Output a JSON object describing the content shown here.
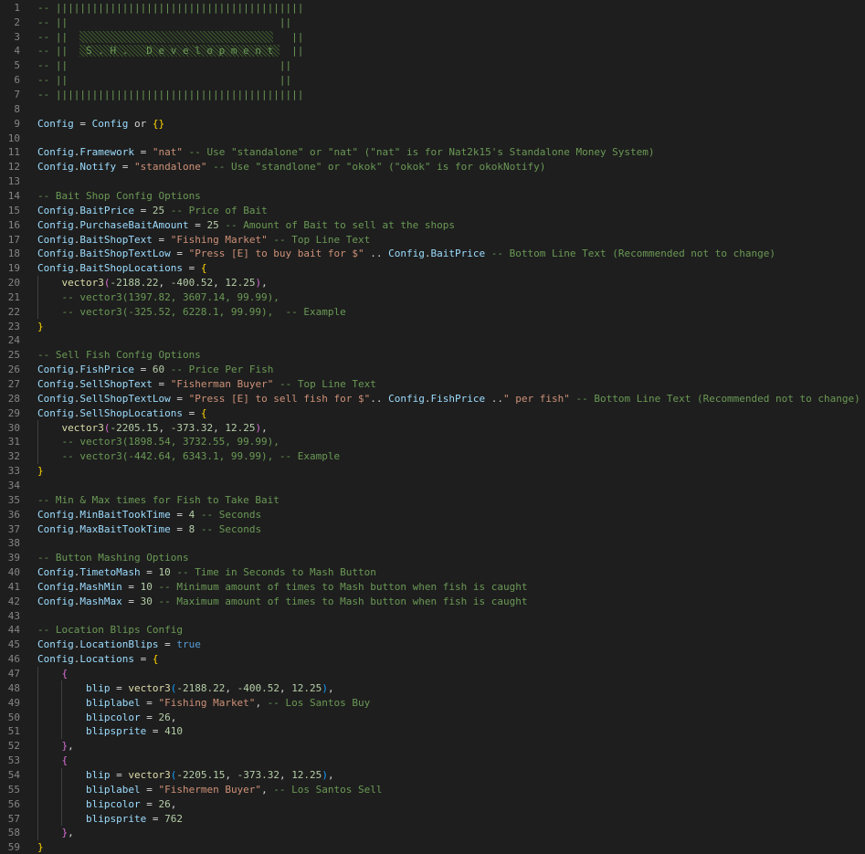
{
  "editor": {
    "lines": [
      [
        [
          "c",
          "-- |||||||||||||||||||||||||||||||||||||||||"
        ]
      ],
      [
        [
          "c",
          "-- ||                                   ||"
        ]
      ],
      [
        [
          "c",
          "-- ||  "
        ],
        [
          "banner",
          "                                "
        ],
        [
          "c",
          "   ||"
        ]
      ],
      [
        [
          "c",
          "-- ||  "
        ],
        [
          "banner",
          " S . H .   D e v e l o p m e n t "
        ],
        [
          "c",
          "  ||"
        ]
      ],
      [
        [
          "c",
          "-- ||                                   ||"
        ]
      ],
      [
        [
          "c",
          "-- ||                                   ||"
        ]
      ],
      [
        [
          "c",
          "-- |||||||||||||||||||||||||||||||||||||||||"
        ]
      ],
      [],
      [
        [
          "v",
          "Config"
        ],
        [
          "o",
          " = "
        ],
        [
          "v",
          "Config"
        ],
        [
          "o",
          " or "
        ],
        [
          "br",
          "{}"
        ]
      ],
      [],
      [
        [
          "v",
          "Config"
        ],
        [
          "o",
          "."
        ],
        [
          "v",
          "Framework"
        ],
        [
          "o",
          " = "
        ],
        [
          "s",
          "\"nat\""
        ],
        [
          "c",
          " -- Use \"standalone\" or \"nat\" (\"nat\" is for Nat2k15's Standalone Money System)"
        ]
      ],
      [
        [
          "v",
          "Config"
        ],
        [
          "o",
          "."
        ],
        [
          "v",
          "Notify"
        ],
        [
          "o",
          " = "
        ],
        [
          "s",
          "\"standalone\""
        ],
        [
          "c",
          " -- Use \"standlone\" or \"okok\" (\"okok\" is for okokNotify)"
        ]
      ],
      [],
      [
        [
          "c",
          "-- Bait Shop Config Options"
        ]
      ],
      [
        [
          "v",
          "Config"
        ],
        [
          "o",
          "."
        ],
        [
          "v",
          "BaitPrice"
        ],
        [
          "o",
          " = "
        ],
        [
          "n",
          "25"
        ],
        [
          "c",
          " -- Price of Bait"
        ]
      ],
      [
        [
          "v",
          "Config"
        ],
        [
          "o",
          "."
        ],
        [
          "v",
          "PurchaseBaitAmount"
        ],
        [
          "o",
          " = "
        ],
        [
          "n",
          "25"
        ],
        [
          "c",
          " -- Amount of Bait to sell at the shops"
        ]
      ],
      [
        [
          "v",
          "Config"
        ],
        [
          "o",
          "."
        ],
        [
          "v",
          "BaitShopText"
        ],
        [
          "o",
          " = "
        ],
        [
          "s",
          "\"Fishing Market\""
        ],
        [
          "c",
          " -- Top Line Text"
        ]
      ],
      [
        [
          "v",
          "Config"
        ],
        [
          "o",
          "."
        ],
        [
          "v",
          "BaitShopTextLow"
        ],
        [
          "o",
          " = "
        ],
        [
          "s",
          "\"Press [E] to buy bait for $\""
        ],
        [
          "o",
          " .. "
        ],
        [
          "v",
          "Config"
        ],
        [
          "o",
          "."
        ],
        [
          "v",
          "BaitPrice"
        ],
        [
          "c",
          " -- Bottom Line Text (Recommended not to change)"
        ]
      ],
      [
        [
          "v",
          "Config"
        ],
        [
          "o",
          "."
        ],
        [
          "v",
          "BaitShopLocations"
        ],
        [
          "o",
          " = "
        ],
        [
          "br",
          "{"
        ]
      ],
      [
        [
          "o",
          "    "
        ],
        [
          "p",
          "vector3"
        ],
        [
          "b2",
          "("
        ],
        [
          "n",
          "-2188.22"
        ],
        [
          "o",
          ", "
        ],
        [
          "n",
          "-400.52"
        ],
        [
          "o",
          ", "
        ],
        [
          "n",
          "12.25"
        ],
        [
          "b2",
          ")"
        ],
        [
          "o",
          ","
        ]
      ],
      [
        [
          "c",
          "    -- vector3(1397.82, 3607.14, 99.99),"
        ]
      ],
      [
        [
          "c",
          "    -- vector3(-325.52, 6228.1, 99.99),  -- Example"
        ]
      ],
      [
        [
          "br",
          "}"
        ]
      ],
      [],
      [
        [
          "c",
          "-- Sell Fish Config Options"
        ]
      ],
      [
        [
          "v",
          "Config"
        ],
        [
          "o",
          "."
        ],
        [
          "v",
          "FishPrice"
        ],
        [
          "o",
          " = "
        ],
        [
          "n",
          "60"
        ],
        [
          "c",
          " -- Price Per Fish"
        ]
      ],
      [
        [
          "v",
          "Config"
        ],
        [
          "o",
          "."
        ],
        [
          "v",
          "SellShopText"
        ],
        [
          "o",
          " = "
        ],
        [
          "s",
          "\"Fisherman Buyer\""
        ],
        [
          "c",
          " -- Top Line Text"
        ]
      ],
      [
        [
          "v",
          "Config"
        ],
        [
          "o",
          "."
        ],
        [
          "v",
          "SellShopTextLow"
        ],
        [
          "o",
          " = "
        ],
        [
          "s",
          "\"Press [E] to sell fish for $\""
        ],
        [
          "o",
          ".. "
        ],
        [
          "v",
          "Config"
        ],
        [
          "o",
          "."
        ],
        [
          "v",
          "FishPrice"
        ],
        [
          "o",
          " .."
        ],
        [
          "s",
          "\" per fish\""
        ],
        [
          "c",
          " -- Bottom Line Text (Recommended not to change)"
        ]
      ],
      [
        [
          "v",
          "Config"
        ],
        [
          "o",
          "."
        ],
        [
          "v",
          "SellShopLocations"
        ],
        [
          "o",
          " = "
        ],
        [
          "br",
          "{"
        ]
      ],
      [
        [
          "o",
          "    "
        ],
        [
          "p",
          "vector3"
        ],
        [
          "b2",
          "("
        ],
        [
          "n",
          "-2205.15"
        ],
        [
          "o",
          ", "
        ],
        [
          "n",
          "-373.32"
        ],
        [
          "o",
          ", "
        ],
        [
          "n",
          "12.25"
        ],
        [
          "b2",
          ")"
        ],
        [
          "o",
          ","
        ]
      ],
      [
        [
          "c",
          "    -- vector3(1898.54, 3732.55, 99.99),"
        ]
      ],
      [
        [
          "c",
          "    -- vector3(-442.64, 6343.1, 99.99), -- Example"
        ]
      ],
      [
        [
          "br",
          "}"
        ]
      ],
      [],
      [
        [
          "c",
          "-- Min & Max times for Fish to Take Bait"
        ]
      ],
      [
        [
          "v",
          "Config"
        ],
        [
          "o",
          "."
        ],
        [
          "v",
          "MinBaitTookTime"
        ],
        [
          "o",
          " = "
        ],
        [
          "n",
          "4"
        ],
        [
          "c",
          " -- Seconds"
        ]
      ],
      [
        [
          "v",
          "Config"
        ],
        [
          "o",
          "."
        ],
        [
          "v",
          "MaxBaitTookTime"
        ],
        [
          "o",
          " = "
        ],
        [
          "n",
          "8"
        ],
        [
          "c",
          " -- Seconds"
        ]
      ],
      [],
      [
        [
          "c",
          "-- Button Mashing Options"
        ]
      ],
      [
        [
          "v",
          "Config"
        ],
        [
          "o",
          "."
        ],
        [
          "v",
          "TimetoMash"
        ],
        [
          "o",
          " = "
        ],
        [
          "n",
          "10"
        ],
        [
          "c",
          " -- Time in Seconds to Mash Button"
        ]
      ],
      [
        [
          "v",
          "Config"
        ],
        [
          "o",
          "."
        ],
        [
          "v",
          "MashMin"
        ],
        [
          "o",
          " = "
        ],
        [
          "n",
          "10"
        ],
        [
          "c",
          " -- Minimum amount of times to Mash button when fish is caught"
        ]
      ],
      [
        [
          "v",
          "Config"
        ],
        [
          "o",
          "."
        ],
        [
          "v",
          "MashMax"
        ],
        [
          "o",
          " = "
        ],
        [
          "n",
          "30"
        ],
        [
          "c",
          " -- Maximum amount of times to Mash button when fish is caught"
        ]
      ],
      [],
      [
        [
          "c",
          "-- Location Blips Config"
        ]
      ],
      [
        [
          "v",
          "Config"
        ],
        [
          "o",
          "."
        ],
        [
          "v",
          "LocationBlips"
        ],
        [
          "o",
          " = "
        ],
        [
          "k",
          "true"
        ]
      ],
      [
        [
          "v",
          "Config"
        ],
        [
          "o",
          "."
        ],
        [
          "v",
          "Locations"
        ],
        [
          "o",
          " = "
        ],
        [
          "br",
          "{"
        ]
      ],
      [
        [
          "o",
          "    "
        ],
        [
          "b2",
          "{"
        ]
      ],
      [
        [
          "o",
          "        "
        ],
        [
          "v",
          "blip"
        ],
        [
          "o",
          " = "
        ],
        [
          "p",
          "vector3"
        ],
        [
          "b3",
          "("
        ],
        [
          "n",
          "-2188.22"
        ],
        [
          "o",
          ", "
        ],
        [
          "n",
          "-400.52"
        ],
        [
          "o",
          ", "
        ],
        [
          "n",
          "12.25"
        ],
        [
          "b3",
          ")"
        ],
        [
          "o",
          ","
        ]
      ],
      [
        [
          "o",
          "        "
        ],
        [
          "v",
          "bliplabel"
        ],
        [
          "o",
          " = "
        ],
        [
          "s",
          "\"Fishing Market\""
        ],
        [
          "o",
          ","
        ],
        [
          "c",
          " -- Los Santos Buy"
        ]
      ],
      [
        [
          "o",
          "        "
        ],
        [
          "v",
          "blipcolor"
        ],
        [
          "o",
          " = "
        ],
        [
          "n",
          "26"
        ],
        [
          "o",
          ","
        ]
      ],
      [
        [
          "o",
          "        "
        ],
        [
          "v",
          "blipsprite"
        ],
        [
          "o",
          " = "
        ],
        [
          "n",
          "410"
        ]
      ],
      [
        [
          "o",
          "    "
        ],
        [
          "b2",
          "}"
        ],
        [
          "o",
          ","
        ]
      ],
      [
        [
          "o",
          "    "
        ],
        [
          "b2",
          "{"
        ]
      ],
      [
        [
          "o",
          "        "
        ],
        [
          "v",
          "blip"
        ],
        [
          "o",
          " = "
        ],
        [
          "p",
          "vector3"
        ],
        [
          "b3",
          "("
        ],
        [
          "n",
          "-2205.15"
        ],
        [
          "o",
          ", "
        ],
        [
          "n",
          "-373.32"
        ],
        [
          "o",
          ", "
        ],
        [
          "n",
          "12.25"
        ],
        [
          "b3",
          ")"
        ],
        [
          "o",
          ","
        ]
      ],
      [
        [
          "o",
          "        "
        ],
        [
          "v",
          "bliplabel"
        ],
        [
          "o",
          " = "
        ],
        [
          "s",
          "\"Fishermen Buyer\""
        ],
        [
          "o",
          ","
        ],
        [
          "c",
          " -- Los Santos Sell"
        ]
      ],
      [
        [
          "o",
          "        "
        ],
        [
          "v",
          "blipcolor"
        ],
        [
          "o",
          " = "
        ],
        [
          "n",
          "26"
        ],
        [
          "o",
          ","
        ]
      ],
      [
        [
          "o",
          "        "
        ],
        [
          "v",
          "blipsprite"
        ],
        [
          "o",
          " = "
        ],
        [
          "n",
          "762"
        ]
      ],
      [
        [
          "o",
          "    "
        ],
        [
          "b2",
          "}"
        ],
        [
          "o",
          ","
        ]
      ],
      [
        [
          "br",
          "}"
        ]
      ]
    ]
  }
}
